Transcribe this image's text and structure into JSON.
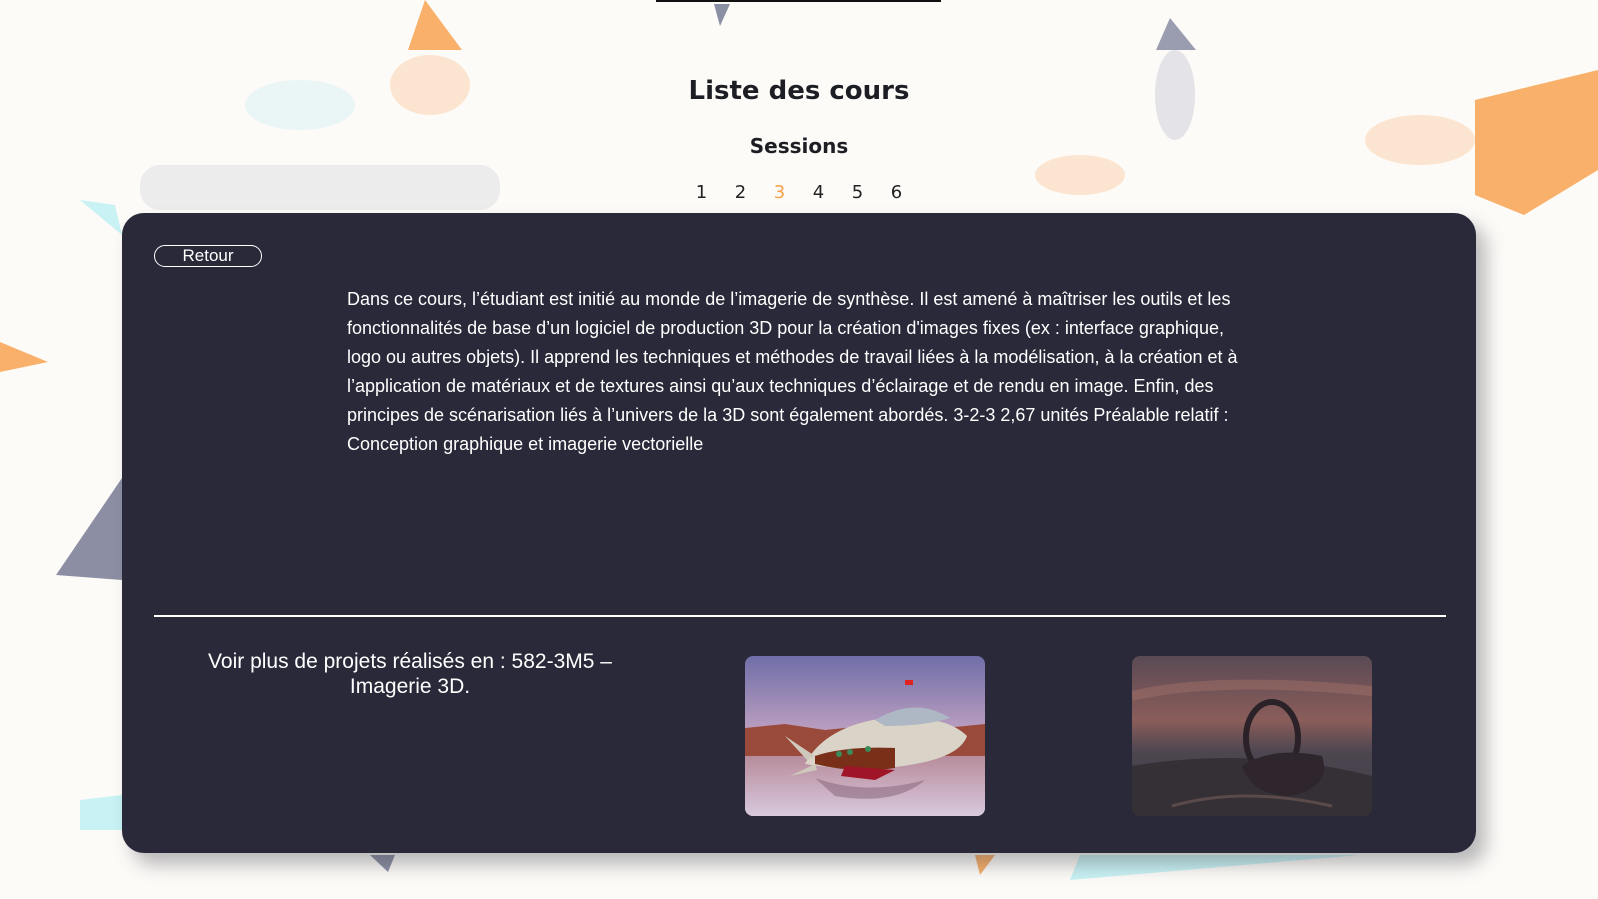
{
  "header": {
    "title": "Liste des cours",
    "sessions_label": "Sessions",
    "sessions": [
      "1",
      "2",
      "3",
      "4",
      "5",
      "6"
    ],
    "active_session": "3"
  },
  "course": {
    "back_label": "Retour",
    "description": "Dans ce cours, l’étudiant est initié au monde de l’imagerie de synthèse. Il est amené à maîtriser les outils et les fonctionnalités de base d’un logiciel de production 3D pour la création d'images fixes (ex : interface graphique, logo ou autres objets). Il apprend les techniques et méthodes de travail liées à la modélisation, à la création et à l’application de matériaux et de textures ainsi qu’aux techniques d’éclairage et de rendu en image. Enfin, des principes de scénarisation liés à l’univers de la 3D sont également abordés. 3-2-3 2,67 unités Préalable relatif : Conception graphique et imagerie vectorielle",
    "more_projects_text": "Voir plus de projets réalisés en : 582-3M5 – Imagerie 3D."
  },
  "colors": {
    "background": "#fdfbf8",
    "card": "#292939",
    "accent": "#f5a04a"
  },
  "projects": [
    {
      "name": "spaceship-render"
    },
    {
      "name": "ring-structure-render"
    }
  ]
}
